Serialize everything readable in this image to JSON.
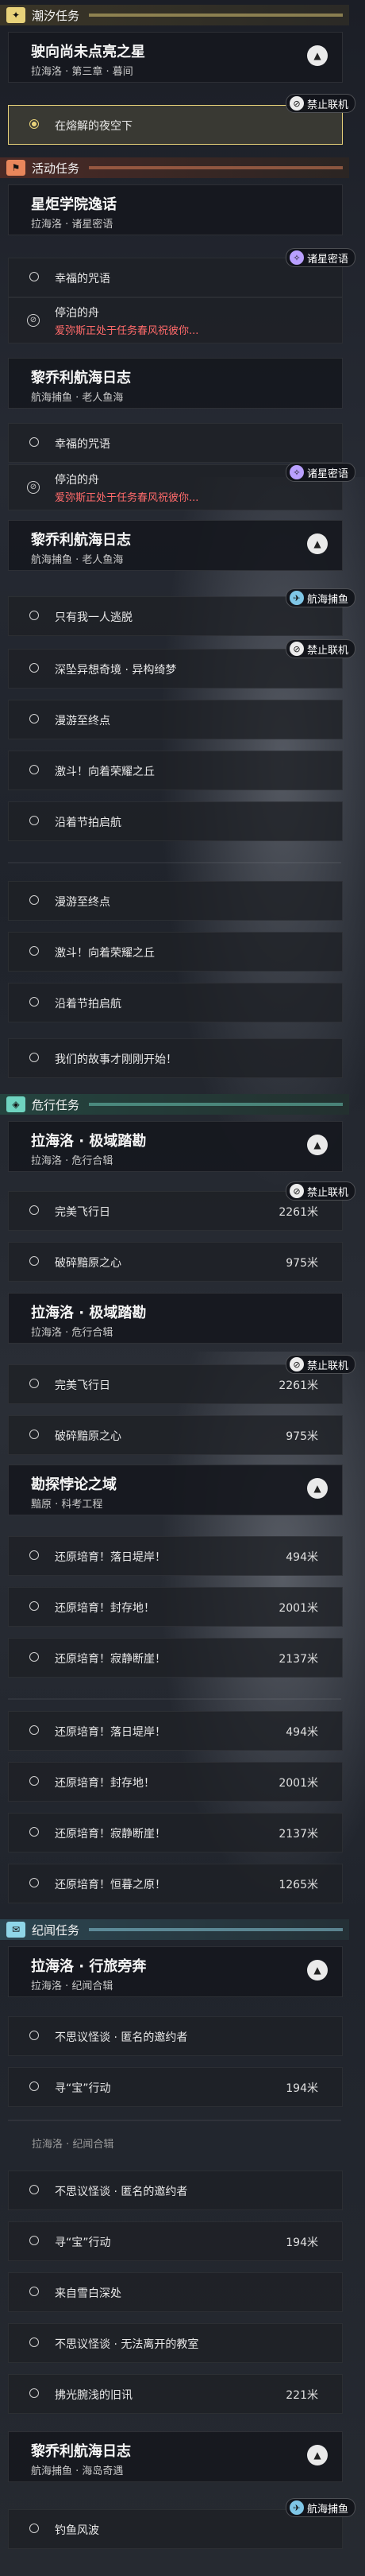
{
  "sections": {
    "chaoxi": "潮汐任务",
    "huodong": "活动任务",
    "weixing": "危行任务",
    "jiyuan": "纪闻任务"
  },
  "badges": {
    "ban": "禁止联机",
    "star": "诸星密语",
    "fish": "航海捕鱼"
  },
  "q1": {
    "title": "驶向尚未点亮之星",
    "sub": "拉海洛 · 第三章 · 暮间",
    "step": "在熔解的夜空下"
  },
  "q2": {
    "title": "星炬学院逸话",
    "sub": "拉海洛 · 诸星密语",
    "step1": "幸福的咒语",
    "step2": "停泊的舟",
    "warn": "爱弥斯正处于任务春风祝彼你..."
  },
  "q3": {
    "title": "黎乔利航海日志",
    "sub": "航海捕鱼 · 老人鱼海"
  },
  "q3b": {
    "step1": "幸福的咒语",
    "step2": "停泊的舟",
    "warn": "爱弥斯正处于任务春风祝彼你..."
  },
  "q4": {
    "title": "黎乔利航海日志",
    "sub": "航海捕鱼 · 老人鱼海",
    "steps": [
      "只有我一人逃脱",
      "深坠异想奇境 · 异构绮梦",
      "漫游至终点",
      "激斗！向着荣耀之丘",
      "沿着节拍启航"
    ],
    "steps2": [
      "漫游至终点",
      "激斗！向着荣耀之丘",
      "沿着节拍启航",
      "我们的故事才刚刚开始！"
    ]
  },
  "q5": {
    "title": "拉海洛 · 极域踏勘",
    "sub": "拉海洛 · 危行合辑",
    "s1": "完美飞行日",
    "d1": "2261米",
    "s2": "破碎黯原之心",
    "d2": "975米"
  },
  "q6": {
    "title": "拉海洛 · 极域踏勘",
    "sub": "拉海洛 · 危行合辑",
    "s1": "完美飞行日",
    "d1": "2261米",
    "s2": "破碎黯原之心",
    "d2": "975米"
  },
  "q7": {
    "title": "勘探悖论之域",
    "sub": "黯原 · 科考工程",
    "rows": [
      [
        "还原培育！落日堤岸！",
        "494米"
      ],
      [
        "还原培育！封存地！",
        "2001米"
      ],
      [
        "还原培育！寂静断崖！",
        "2137米"
      ]
    ],
    "rows2": [
      [
        "还原培育！落日堤岸！",
        "494米"
      ],
      [
        "还原培育！封存地！",
        "2001米"
      ],
      [
        "还原培育！寂静断崖！",
        "2137米"
      ],
      [
        "还原培育！恒暮之原！",
        "1265米"
      ]
    ]
  },
  "q8": {
    "title": "拉海洛 · 行旅旁奔",
    "sub": "拉海洛 · 纪闻合辑",
    "rows": [
      [
        "不思议怪谈 · 匿名的邀约者",
        ""
      ],
      [
        "寻“宝”行动",
        "194米"
      ]
    ],
    "rows2": [
      [
        "不思议怪谈 · 匿名的邀约者",
        ""
      ],
      [
        "寻“宝”行动",
        "194米"
      ],
      [
        "来自雪白深处",
        ""
      ],
      [
        "不思议怪谈 · 无法离开的教室",
        ""
      ],
      [
        "拂光腕浅的旧讯",
        "221米"
      ]
    ],
    "partial": "拉海洛 · 纪闻合辑"
  },
  "q9": {
    "title": "黎乔利航海日志",
    "sub": "航海捕鱼 · 海岛奇遇",
    "step": "钓鱼风波"
  },
  "colors": {
    "accent_yellow": "#e8d27a",
    "warn_red": "#ff6a6a",
    "teal": "#6fd4c0"
  }
}
